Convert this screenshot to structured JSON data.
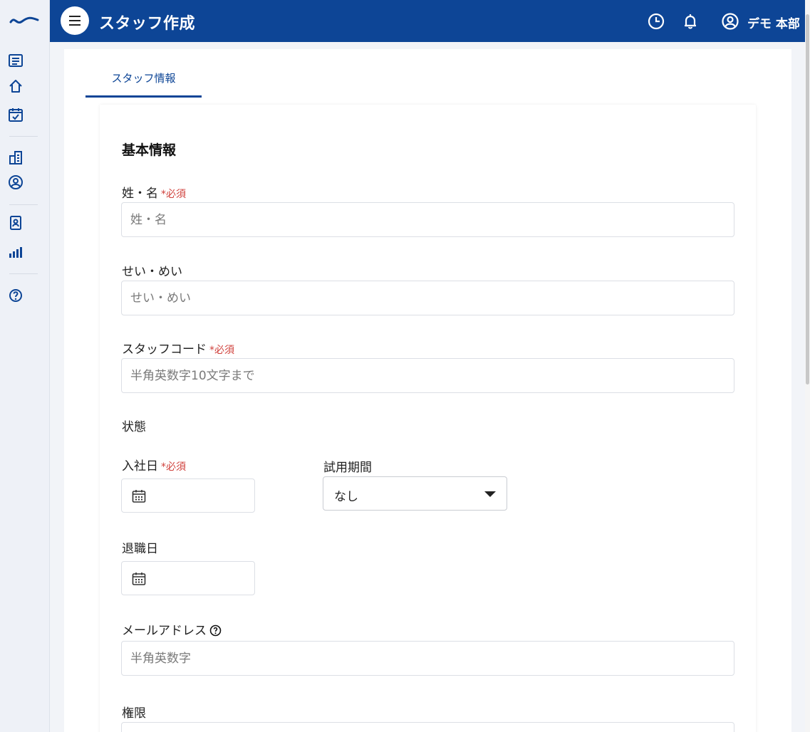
{
  "header": {
    "title": "スタッフ作成",
    "user_name": "デモ 本部"
  },
  "colors": {
    "primary": "#0d4596",
    "required": "#d0413c",
    "background": "#f2f4f8"
  },
  "sidebar": {
    "icons": [
      "document-list-icon",
      "home-icon",
      "calendar-check-icon",
      "building-icon",
      "user-circle-icon",
      "id-badge-icon",
      "bar-chart-icon",
      "help-icon"
    ]
  },
  "tabs": {
    "staff_info": "スタッフ情報"
  },
  "form": {
    "section_title": "基本情報",
    "required_mark": "*必須",
    "name": {
      "label": "姓・名",
      "placeholder": "姓・名"
    },
    "kana": {
      "label": "せい・めい",
      "placeholder": "せい・めい"
    },
    "staff_code": {
      "label": "スタッフコード",
      "placeholder": "半角英数字10文字まで"
    },
    "status_label": "状態",
    "join_date": {
      "label": "入社日"
    },
    "trial": {
      "label": "試用期間",
      "value": "なし"
    },
    "leave_date": {
      "label": "退職日"
    },
    "email": {
      "label": "メールアドレス",
      "placeholder": "半角英数字"
    },
    "permission": {
      "label": "権限"
    }
  }
}
